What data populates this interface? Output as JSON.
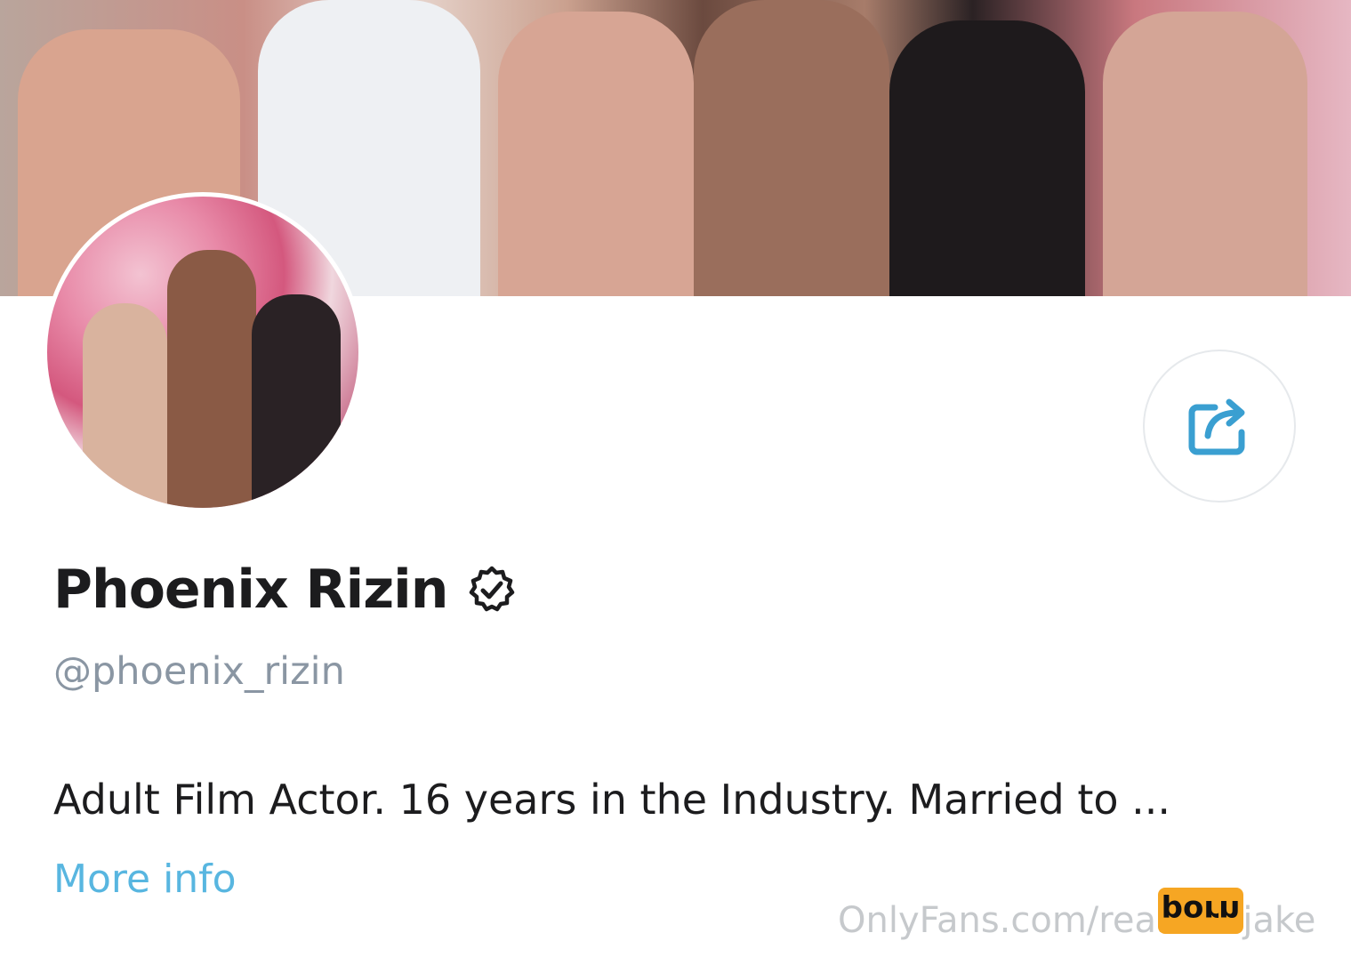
{
  "profile": {
    "display_name": "Phoenix Rizin",
    "username": "@phoenix_rizin",
    "verified": true,
    "bio": "Adult Film Actor. 16 years in the Industry. Married to ...",
    "more_info_label": "More info"
  },
  "icons": {
    "verified": "verified-badge-icon",
    "share": "share-icon"
  },
  "colors": {
    "accent": "#58b6e0",
    "muted": "#8a96a3",
    "text": "#1c1c1e",
    "badge": "#f6a623"
  },
  "watermark": {
    "text": "OnlyFans.com/realcumjake",
    "badge_label": "porn"
  }
}
